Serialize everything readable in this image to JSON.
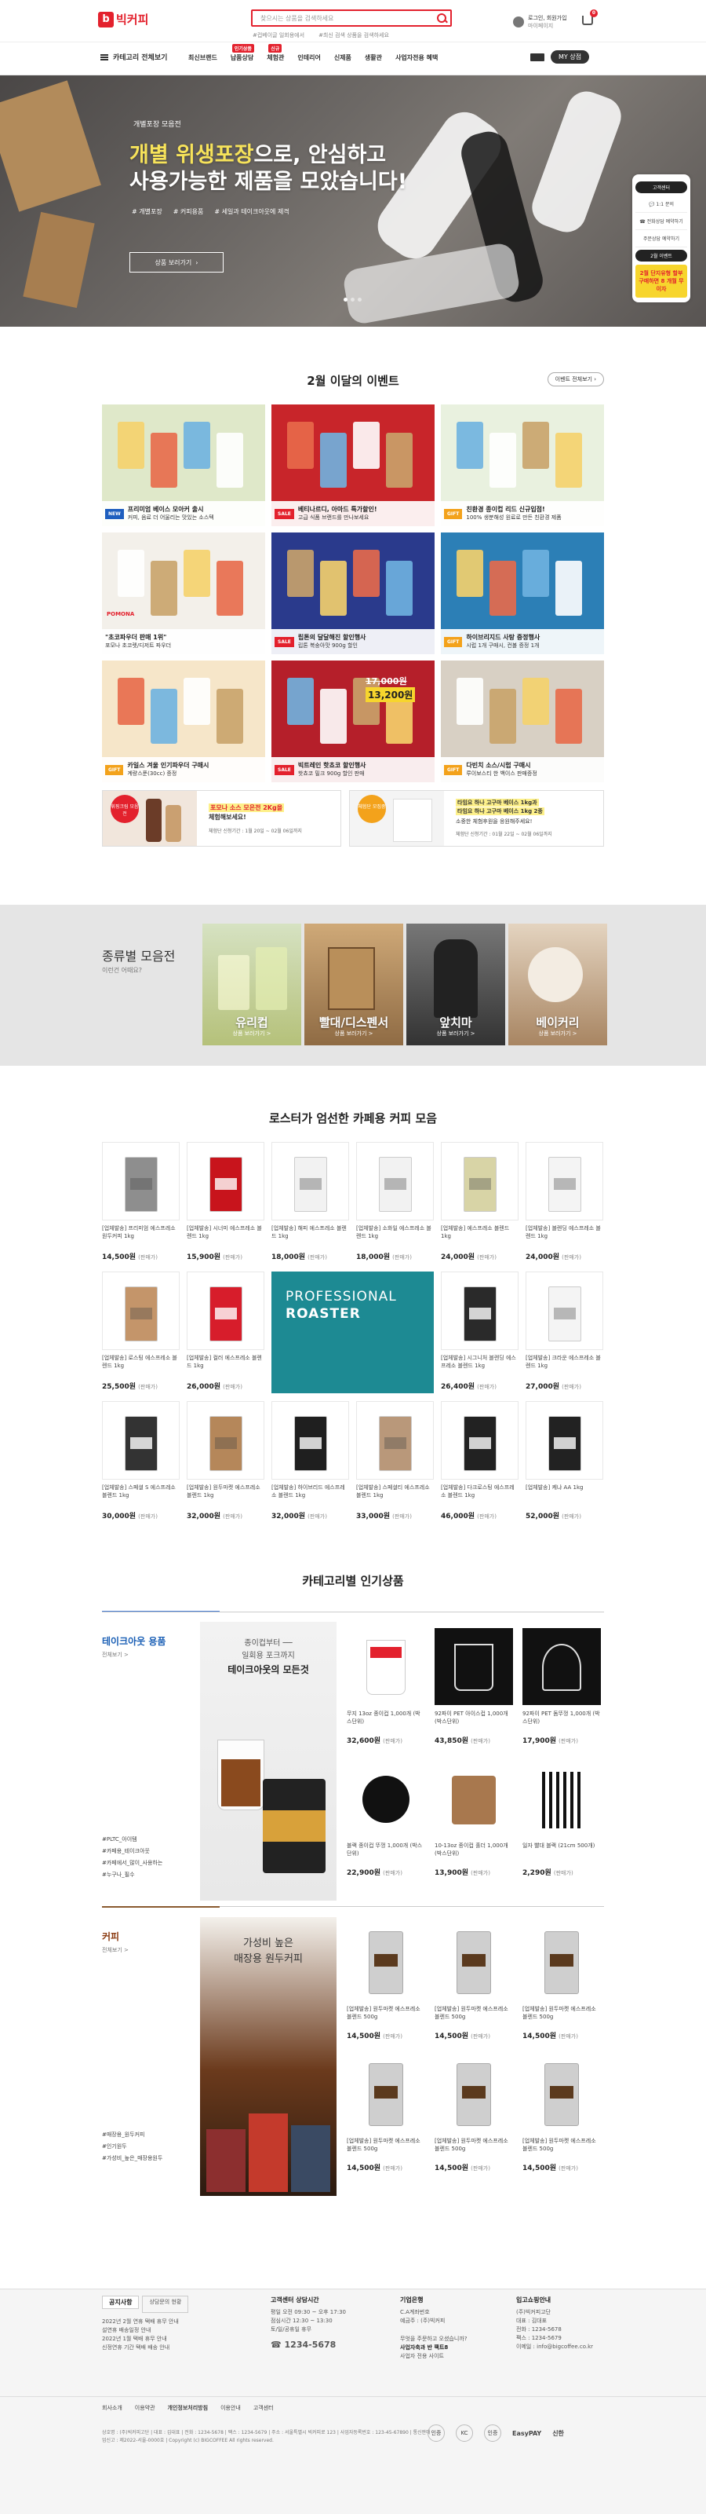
{
  "header": {
    "logo_text": "빅커피",
    "search_placeholder": "찾으시는 상품을 검색하세요",
    "recent": [
      "#컵베이글 일회용에서",
      "#최신 검색 상품을 검색하세요"
    ],
    "user_name": "로그인, 회원가입",
    "user_sub": "마이페이지",
    "cart_count": "0"
  },
  "nav": {
    "categories_label": "카테고리 전체보기",
    "items": [
      {
        "label": "최신브랜드",
        "badge": ""
      },
      {
        "label": "납품상담",
        "badge": "인기상품"
      },
      {
        "label": "체험관",
        "badge": "신규"
      },
      {
        "label": "인테리어",
        "badge": ""
      },
      {
        "label": "신제품",
        "badge": ""
      },
      {
        "label": "생활관",
        "badge": ""
      },
      {
        "label": "사업자전용 혜택",
        "badge": ""
      }
    ],
    "myset": "MY 상점"
  },
  "banner": {
    "sub": "개별포장 모음전",
    "title_hl": "개별 위생포장",
    "title_rest": "으로, 안심하고",
    "title2": "사용가능한 제품을 모았습니다!",
    "tags": [
      "# 개별포장",
      "# 커피용품",
      "# 세일과 테이크아웃에 제격"
    ],
    "button": "상품 보러가기",
    "slides": 3
  },
  "side": {
    "pill": "고객센터",
    "inquiry": "1:1 문의",
    "chat": "전화상담 예약하기",
    "order": "주문상담 예약하기",
    "event": "2월 이벤트",
    "ad": "2월 단지유형 할부 구매하면 8 개월 무이자"
  },
  "events": {
    "title": "2월 이달의 이벤트",
    "all": "이벤트 전체보기",
    "cards": [
      {
        "tag": "NEW",
        "tag_color": "#1f5fbf",
        "title": "프리미엄 베이스 모아커 출시",
        "sub": "커피, 음료 더 어울리는 맛있는 소스텍",
        "bg": "#dfe8c9"
      },
      {
        "tag": "SALE",
        "tag_color": "#e3212d",
        "title": "베티나르디, 아마드 특가할인!",
        "sub": "고급 식품 브랜드를 만나보세요",
        "bg": "#c8252a"
      },
      {
        "tag": "GIFT",
        "tag_color": "#f3a21b",
        "title": "친환경 종이컵 리드 신규입점!",
        "sub": "100% 생분해성 원료로 만든 친환경 제품",
        "bg": "#e9f1df"
      },
      {
        "tag": "",
        "tag_color": "#333",
        "title": "\"초코파우더 판매 1위\"",
        "sub": "포모나 초코렛/디저트 파우더",
        "bg": "#f3f0ea",
        "brand": "POMONA"
      },
      {
        "tag": "SALE",
        "tag_color": "#e3212d",
        "title": "립톤의 달달해진 할인행사",
        "sub": "립톤 복숭아맛 900g 할인",
        "bg": "#2a3a8c"
      },
      {
        "tag": "GIFT",
        "tag_color": "#f3a21b",
        "title": "하이브리지드 사탕 증정행사",
        "sub": "시럽 1개 구매시, 컨볼 증정 1개",
        "bg": "#2c7fb6"
      },
      {
        "tag": "GIFT",
        "tag_color": "#f3a21b",
        "title": "카일스 겨울 인기파우더 구매시",
        "sub": "계량스푼(30cc) 증정",
        "bg": "#f6e6c9"
      },
      {
        "tag": "SALE",
        "tag_color": "#e3212d",
        "title": "빅트레인 핫쵸코 할인행사",
        "sub": "핫쵸코 밀크 900g 할인 판매",
        "bg": "#b51f2a",
        "price_old": "17,000원",
        "price_new": "13,200원"
      },
      {
        "tag": "GIFT",
        "tag_color": "#f3a21b",
        "title": "다빈치 소스/시럽 구매시",
        "sub": "루이보스티 한 백이스 판매증정",
        "bg": "#d8d0c4"
      }
    ],
    "small": [
      {
        "tag": "휘핑크림 모음전",
        "title": "포모나 소스 모은전 2Kg을",
        "title2": "체험해보세요!",
        "sub": "체험단 신청기간 : 1월 20일 ~ 02월 06일까지"
      },
      {
        "tag": "체험단 모집중",
        "title": "타임요 하나 고구마 베이스 1kg과",
        "title2": "타임요 하나 고구마 베이스 1kg 2종",
        "sub2": "소중한 체험후원을 응원해주세요!",
        "sub": "체험단 신청기간 : 01월 22일 ~ 02월 06일까지"
      }
    ]
  },
  "categories": {
    "title": "종류별 모음전",
    "sub": "이런건 어때요?",
    "items": [
      {
        "name": "유리컵",
        "link": "상품 보러가기 >"
      },
      {
        "name": "빨대/디스펜서",
        "link": "상품 보러가기 >"
      },
      {
        "name": "앞치마",
        "link": "상품 보러가기 >"
      },
      {
        "name": "베이커리",
        "link": "상품 보러가기 >"
      }
    ]
  },
  "coffee": {
    "title": "로스터가 엄선한 카페용 커피 모음",
    "banner1": "PROFESSIONAL",
    "banner2": "ROASTER",
    "products": [
      {
        "name": "[업체발송] 프리미엄 에스프레소 원두커피 1kg",
        "price": "14,500원",
        "unit": "(판매가)",
        "c": "#8e8e8e"
      },
      {
        "name": "[업체발송] 시너미 에스프레소 블렌드 1kg",
        "price": "15,900원",
        "unit": "(판매가)",
        "c": "#c8141c"
      },
      {
        "name": "[업체발송] 해피 에스프레소 블렌드 1kg",
        "price": "18,000원",
        "unit": "(판매가)",
        "c": "#f2f2f2"
      },
      {
        "name": "[업체발송] 소화일 에스프레소 블렌드 1kg",
        "price": "18,000원",
        "unit": "(판매가)",
        "c": "#f2f2f2"
      },
      {
        "name": "[업체발송] 에스프레소 블렌드 1kg",
        "price": "24,000원",
        "unit": "(판매가)",
        "c": "#d8d4a6"
      },
      {
        "name": "[업체발송] 블렌딩 에스프레소 블렌드 1kg",
        "price": "24,000원",
        "unit": "(판매가)",
        "c": "#f4f4f4"
      },
      {
        "name": "[업체발송] 로스팅 에스프레소 블렌드 1kg",
        "price": "25,500원",
        "unit": "(판매가)",
        "c": "#c4956a"
      },
      {
        "name": "[업체발송] 컬러 에스프레소 블렌드 1kg",
        "price": "26,000원",
        "unit": "(판매가)",
        "c": "#d71d2b"
      },
      {
        "name": "",
        "price": "",
        "unit": "",
        "c": "banner"
      },
      {
        "name": "",
        "price": "",
        "unit": "",
        "c": "banner"
      },
      {
        "name": "[업체발송] 시그니처 블렌딩 에스프레소 블렌드 1kg",
        "price": "26,400원",
        "unit": "(판매가)",
        "c": "#2a2a2a"
      },
      {
        "name": "[업체발송] 크라운 에스프레소 블렌드 1kg",
        "price": "27,000원",
        "unit": "(판매가)",
        "c": "#f4f4f4"
      },
      {
        "name": "[업체발송] 스페셜 S 에스프레소 블렌드 1kg",
        "price": "30,000원",
        "unit": "(판매가)",
        "c": "#333333"
      },
      {
        "name": "[업체발송] 원두마켓 에스프레소 블렌드 1kg",
        "price": "32,000원",
        "unit": "(판매가)",
        "c": "#b5875a"
      },
      {
        "name": "[업체발송] 하이브리드 에스프레소 블렌드 1kg",
        "price": "32,000원",
        "unit": "(판매가)",
        "c": "#1f1f1f"
      },
      {
        "name": "[업체발송] 스페셜티 에스프레소 블렌드 1kg",
        "price": "33,000원",
        "unit": "(판매가)",
        "c": "#b9987a"
      },
      {
        "name": "[업체발송] 다크로스팅 에스프레소 블렌드 1kg",
        "price": "46,000원",
        "unit": "(판매가)",
        "c": "#222222"
      },
      {
        "name": "[업체발송] 케냐 AA 1kg",
        "price": "52,000원",
        "unit": "(판매가)",
        "c": "#222222"
      }
    ]
  },
  "popular": {
    "title": "카테고리별 인기상품",
    "groups": [
      {
        "name": "테이크아웃 용품",
        "more": "전체보기 >",
        "promo1": "종이컵부터 ──",
        "promo2": "일회용 포크까지",
        "promo3": "테이크아웃의 모든것",
        "tags": [
          "#PLTC_아이템",
          "#카페용_테이크아웃",
          "#카페에서_많이_사용하는",
          "#누구나_필수"
        ],
        "products": [
          {
            "name": "무지 13oz 종이컵 1,000개 (박스단위)",
            "price": "32,600원",
            "unit": "(판매가)",
            "kind": "cup"
          },
          {
            "name": "92파이 PET 아이스컵 1,000개 (박스단위)",
            "price": "43,850원",
            "unit": "(판매가)",
            "kind": "pet"
          },
          {
            "name": "92파이 PET 돔뚜껑 1,000개 (박스단위)",
            "price": "17,900원",
            "unit": "(판매가)",
            "kind": "lid"
          },
          {
            "name": "블랙 종이컵 뚜껑 1,000개 (박스단위)",
            "price": "22,900원",
            "unit": "(판매가)",
            "kind": "blacklid"
          },
          {
            "name": "10-13oz 종이컵 홀더 1,000개 (박스단위)",
            "price": "13,900원",
            "unit": "(판매가)",
            "kind": "holder"
          },
          {
            "name": "일자 빨대 블랙 (21cm 500개)",
            "price": "2,290원",
            "unit": "(판매가)",
            "kind": "straw"
          }
        ]
      },
      {
        "name": "커피",
        "more": "전체보기 >",
        "promo1": "가성비 높은",
        "promo2": "매장용 원두커피",
        "promo3": "",
        "tags": [
          "#매장용_원두커피",
          "#인기원두",
          "#가성비_높은_매장용원두"
        ],
        "products": [
          {
            "name": "[업체발송] 원두마켓 에스프레소 블렌드 500g",
            "price": "14,500원",
            "unit": "(판매가)",
            "kind": "bag"
          },
          {
            "name": "[업체발송] 원두마켓 에스프레소 블렌드 500g",
            "price": "14,500원",
            "unit": "(판매가)",
            "kind": "bag"
          },
          {
            "name": "[업체발송] 원두마켓 에스프레소 블렌드 500g",
            "price": "14,500원",
            "unit": "(판매가)",
            "kind": "bag"
          },
          {
            "name": "[업체발송] 원두마켓 에스프레소 블렌드 500g",
            "price": "14,500원",
            "unit": "(판매가)",
            "kind": "bag"
          },
          {
            "name": "[업체발송] 원두마켓 에스프레소 블렌드 500g",
            "price": "14,500원",
            "unit": "(판매가)",
            "kind": "bag"
          },
          {
            "name": "[업체발송] 원두마켓 에스프레소 블렌드 500g",
            "price": "14,500원",
            "unit": "(판매가)",
            "kind": "bag"
          }
        ]
      }
    ]
  },
  "footer": {
    "notice_tab": "공지사항",
    "review_tab": "상담문의 현황",
    "notices": [
      "2022년 2월 연휴 택배 휴무 안내",
      "설연휴 배송일정 안내",
      "2022년 1월 택배 휴무 안내",
      "신정연휴 기간 택배 배송 안내"
    ],
    "cs_title": "고객센터 상담시간",
    "cs_lines": [
      "평일 오전 09:30 ~ 오후 17:30",
      "점심시간 12:30 ~ 13:30",
      "토/일/공휴일 휴무"
    ],
    "cs_phone": "1234-5678",
    "bank_title": "기업은행",
    "bank_lines": [
      "C.A계좌번호",
      "예금주 : (주)빅커피"
    ],
    "bank_q": "무엇을 주문하고 오셨습니까?",
    "bank_biz": "사업자축과 반 팩트8",
    "bank_biz2": "사업자 전용 사이트",
    "shop_title": "입고쇼핑안내",
    "shop_lines": [
      "(주)빅커피고단",
      "대표 : 김대표",
      "전화 : 1234-5678",
      "팩스 : 1234-5679",
      "이메일 : info@bigcoffee.co.kr"
    ],
    "links": [
      "회사소개",
      "이용약관",
      "개인정보처리방침",
      "이용안내",
      "고객센터"
    ],
    "info": "상호명 : (주)빅커피고단 | 대표 : 김대표 | 전화 : 1234-5678 | 팩스 : 1234-5679 | 주소 : 서울특별시 빅커피로 123 | 사업자등록번호 : 123-45-67890 | 통신판매업신고 : 제2022-서울-0000호 | Copyright (c) BIGCOFFEE All rights reserved.",
    "badges": [
      "인증",
      "KC",
      "인증"
    ],
    "pay": "EasyPAY",
    "bank2": "신한"
  }
}
